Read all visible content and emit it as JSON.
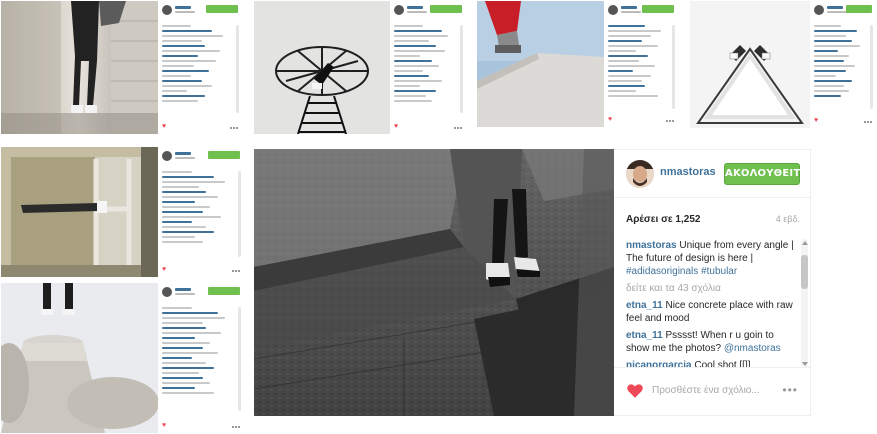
{
  "featured_post": {
    "username": "nmastoras",
    "follow_label": "ΑΚΟΛΟΥΘΕΙΤΕ",
    "likes": "Αρέσει σε 1,252",
    "age": "4 εβδ.",
    "caption": {
      "user": "nmastoras",
      "text": "Unique from every angle | The future of design is here | ",
      "hashtags": "#adidasoriginals #tubular"
    },
    "view_more": "δείτε και τα 43 σχόλια",
    "comments": [
      {
        "user": "etna_11",
        "text": "Nice concrete place with raw feel and mood"
      },
      {
        "user": "etna_11",
        "text": "Psssst! When r u goin to show me the photos? ",
        "mention": "@nmastoras"
      },
      {
        "user": "nicanorgarcia",
        "text": "Cool shot [[]]"
      }
    ],
    "add_comment_placeholder": "Προσθέστε ένα σχόλιο...",
    "more_options_label": "•••"
  },
  "colors": {
    "follow_green": "#70c050",
    "link_blue": "#3f729b",
    "like_red": "#ed4956",
    "muted_grey": "#a5a7aa"
  },
  "icons": {
    "like": "heart-icon",
    "options": "ellipsis-icon"
  }
}
